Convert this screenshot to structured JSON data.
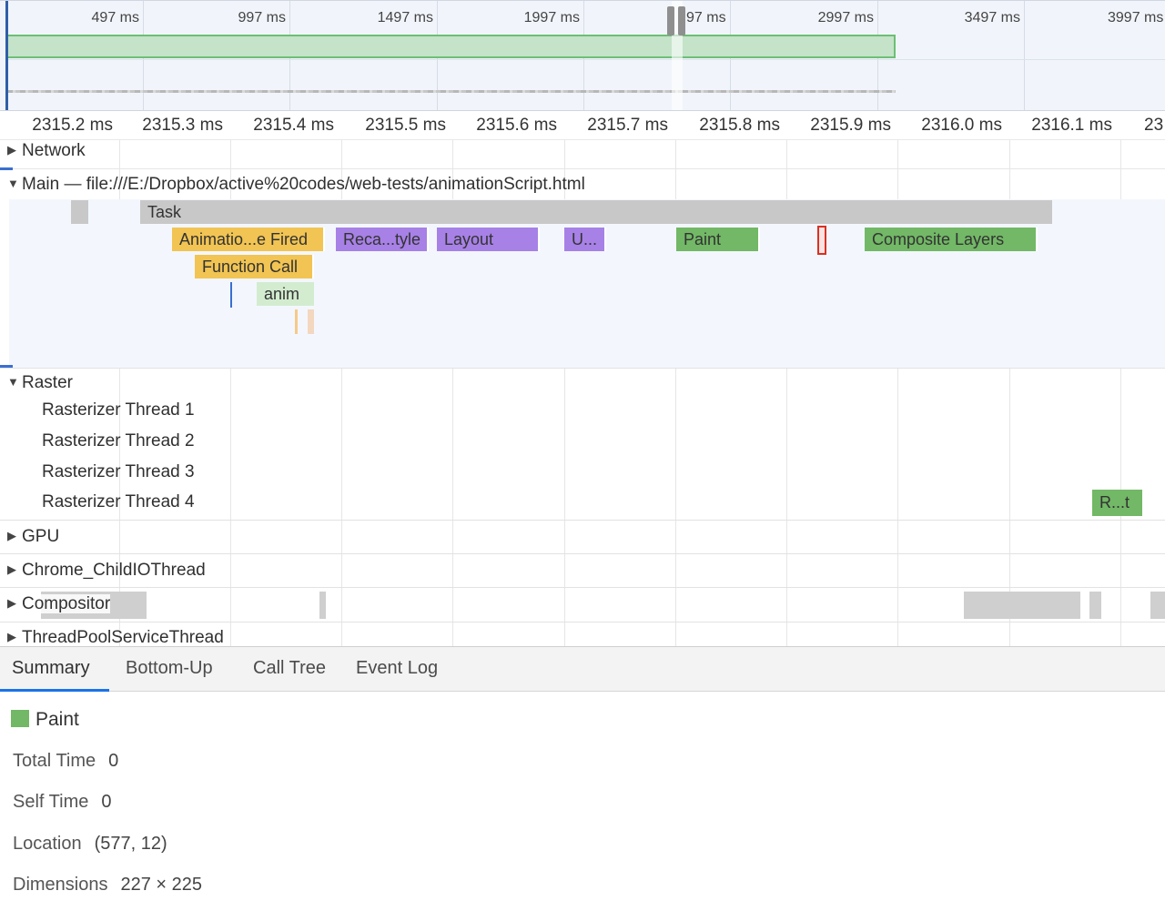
{
  "overview": {
    "tick_labels": [
      "497 ms",
      "997 ms",
      "1497 ms",
      "1997 ms",
      "97 ms",
      "2997 ms",
      "3497 ms",
      "3997 ms"
    ]
  },
  "ruler": {
    "tick_labels": [
      "2315.2 ms",
      "2315.3 ms",
      "2315.4 ms",
      "2315.5 ms",
      "2315.6 ms",
      "2315.7 ms",
      "2315.8 ms",
      "2315.9 ms",
      "2316.0 ms",
      "2316.1 ms",
      "23"
    ]
  },
  "tracks": {
    "network": "Network",
    "main": "Main — file:///E:/Dropbox/active%20codes/web-tests/animationScript.html",
    "raster": "Raster",
    "raster_threads": [
      "Rasterizer Thread 1",
      "Rasterizer Thread 2",
      "Rasterizer Thread 3",
      "Rasterizer Thread 4"
    ],
    "gpu": "GPU",
    "child_io": "Chrome_ChildIOThread",
    "compositor": "Compositor",
    "thread_pool": "ThreadPoolServiceThread"
  },
  "events": {
    "task": "Task",
    "animation_fired": "Animatio...e Fired",
    "recalc_style": "Reca...tyle",
    "layout": "Layout",
    "update": "U...",
    "paint": "Paint",
    "composite": "Composite Layers",
    "function_call": "Function Call",
    "anim": "anim",
    "raster_task": "R...t"
  },
  "tabs": [
    "Summary",
    "Bottom-Up",
    "Call Tree",
    "Event Log"
  ],
  "active_tab": "Summary",
  "summary": {
    "title": "Paint",
    "swatch_color": "#72b866",
    "rows": [
      {
        "label": "Total Time",
        "value": "0"
      },
      {
        "label": "Self Time",
        "value": "0"
      },
      {
        "label": "Location",
        "value": "(577, 12)"
      },
      {
        "label": "Dimensions",
        "value": "227 × 225"
      }
    ]
  },
  "colors": {
    "task": "#c8c8c8",
    "scripting": "#f1c453",
    "rendering": "#a781e6",
    "painting": "#72b866",
    "selection_accent": "#1a73e8"
  }
}
